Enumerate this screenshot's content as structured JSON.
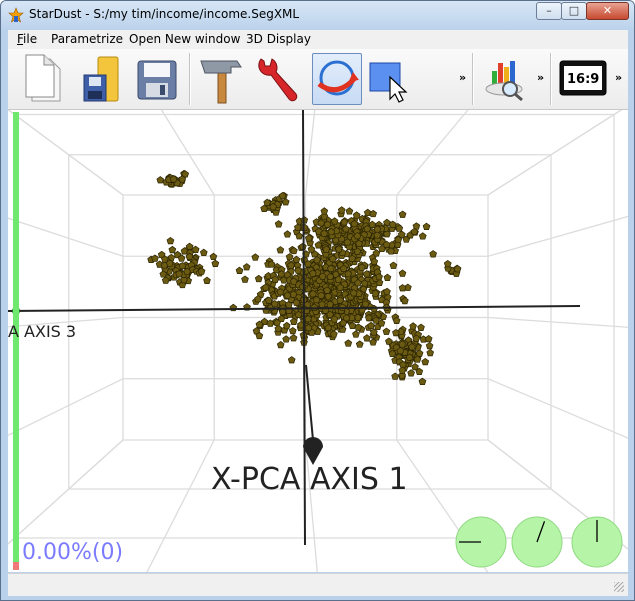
{
  "window": {
    "title": "StarDust - S:/my tim/income/income.SegXML",
    "minimize_glyph": "–",
    "maximize_glyph": "□",
    "close_glyph": "✕"
  },
  "menu": {
    "items": [
      {
        "label": "File",
        "accel": "F",
        "rest": "ile"
      },
      {
        "label": "Parametrize"
      },
      {
        "label": "Open New window"
      },
      {
        "label": "3D Display"
      }
    ]
  },
  "toolbar": {
    "more_glyph": "»",
    "aspect_label": "16:9",
    "buttons": [
      {
        "name": "new-document"
      },
      {
        "name": "open-folder"
      },
      {
        "name": "save"
      },
      {
        "name": "hammer"
      },
      {
        "name": "wrench"
      },
      {
        "name": "rotate"
      },
      {
        "name": "select"
      },
      {
        "name": "chart-search"
      },
      {
        "name": "aspect-16-9"
      }
    ]
  },
  "view": {
    "axis1_label": "X-PCA AXIS 1",
    "axis3_label": "A AXIS 3",
    "progress_text": "0.00%(0)",
    "progress_fraction": 0.0,
    "point_color": "#6b5a12",
    "dials": [
      {
        "needle_angle_deg": 270
      },
      {
        "needle_angle_deg": 20
      },
      {
        "needle_angle_deg": 0
      }
    ]
  }
}
